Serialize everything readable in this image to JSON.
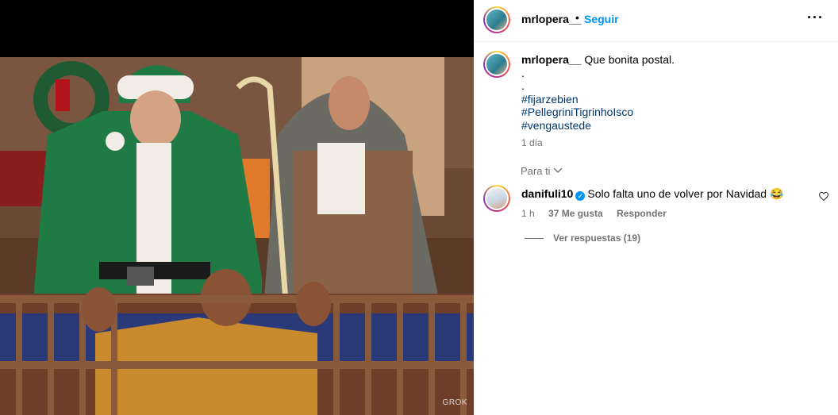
{
  "media": {
    "watermark": "GROK"
  },
  "header": {
    "username": "mrlopera__",
    "dot": "•",
    "follow": "Seguir",
    "more": "···"
  },
  "caption": {
    "username": "mrlopera__",
    "text": "Que bonita postal.",
    "dots": [
      ".",
      "."
    ],
    "hashtags": [
      "#fijarzebien",
      "#PellegriniTigrinhoIsco",
      "#vengaustede"
    ],
    "time": "1 día"
  },
  "para_ti": "Para ti",
  "comment": {
    "username": "danifuli10",
    "text": "Solo falta uno de volver por Navidad 😂",
    "time": "1 h",
    "likes": "37 Me gusta",
    "reply": "Responder",
    "view_replies": "Ver respuestas (19)"
  },
  "colors": {
    "link": "#0095f6",
    "hashtag": "#00376b",
    "muted": "#737373"
  }
}
